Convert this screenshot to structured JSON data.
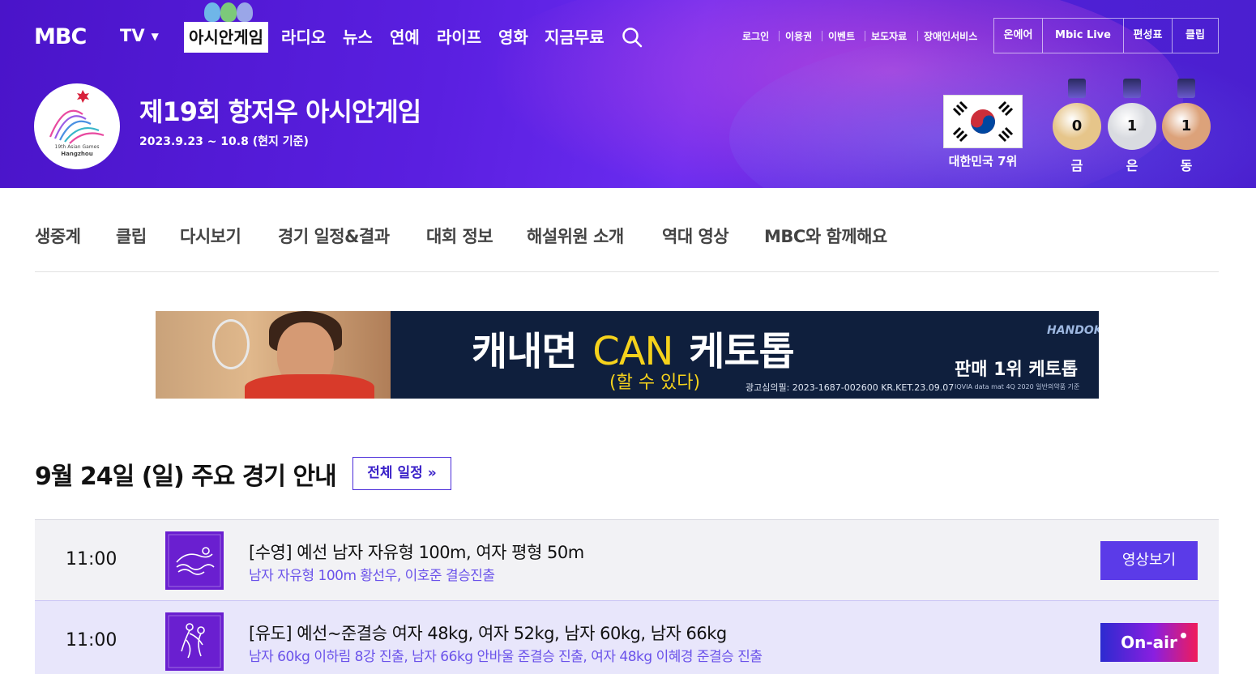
{
  "header": {
    "logo": "MBC",
    "tv_label": "TV",
    "nav": [
      "아시안게임",
      "라디오",
      "뉴스",
      "연예",
      "라이프",
      "영화",
      "지금무료"
    ],
    "util_links": [
      "로그인",
      "이용권",
      "이벤트",
      "보도자료",
      "장애인서비스"
    ],
    "boxed_links": [
      "온에어",
      "Mbic Live",
      "편성표",
      "클립"
    ]
  },
  "event": {
    "logo_text_1": "19th Asian Games",
    "logo_text_2": "Hangzhou",
    "title": "제19회 항저우 아시안게임",
    "date": "2023.9.23 ~ 10.8 (현지 기준)",
    "rank": "대한민국 7위",
    "medals": [
      {
        "label": "금",
        "count": "0",
        "color": "#e6c58a"
      },
      {
        "label": "은",
        "count": "1",
        "color": "#d9dbe0"
      },
      {
        "label": "동",
        "count": "1",
        "color": "#dca27a"
      }
    ]
  },
  "subnav": [
    "생중계",
    "클립",
    "다시보기",
    "경기 일정&결과",
    "대회 정보",
    "해설위원 소개",
    "역대 영상",
    "MBC와 함께해요"
  ],
  "banner": {
    "main_1": "캐내면",
    "main_can": "CAN",
    "main_2": "케토톱",
    "sub": "(할 수 있다)",
    "reg": "광고심의필: 2023-1687-002600 KR.KET.23.09.07",
    "brand": "HANDOK",
    "rank": "판매 1위 케토톱",
    "note": "IQVIA data mat 4Q 2020 일반의약품 기준"
  },
  "schedule": {
    "title": "9월 24일 (일) 주요 경기 안내",
    "all_button": "전체 일정 »",
    "rows": [
      {
        "time": "11:00",
        "sport_icon": "swimming-icon",
        "title": "[수영] 예선 남자 자유형 100m, 여자 평형 50m",
        "result": "남자 자유형 100m 황선우, 이호준 결승진출",
        "button": "영상보기"
      },
      {
        "time": "11:00",
        "sport_icon": "judo-icon",
        "title": "[유도] 예선~준결승 여자 48kg, 여자 52kg, 남자 60kg, 남자 66kg",
        "result": "남자 60kg 이하림 8강 진출, 남자 66kg 안바울 준결승 진출, 여자 48kg 이혜경 준결승 진출",
        "button": "On-air"
      }
    ]
  }
}
